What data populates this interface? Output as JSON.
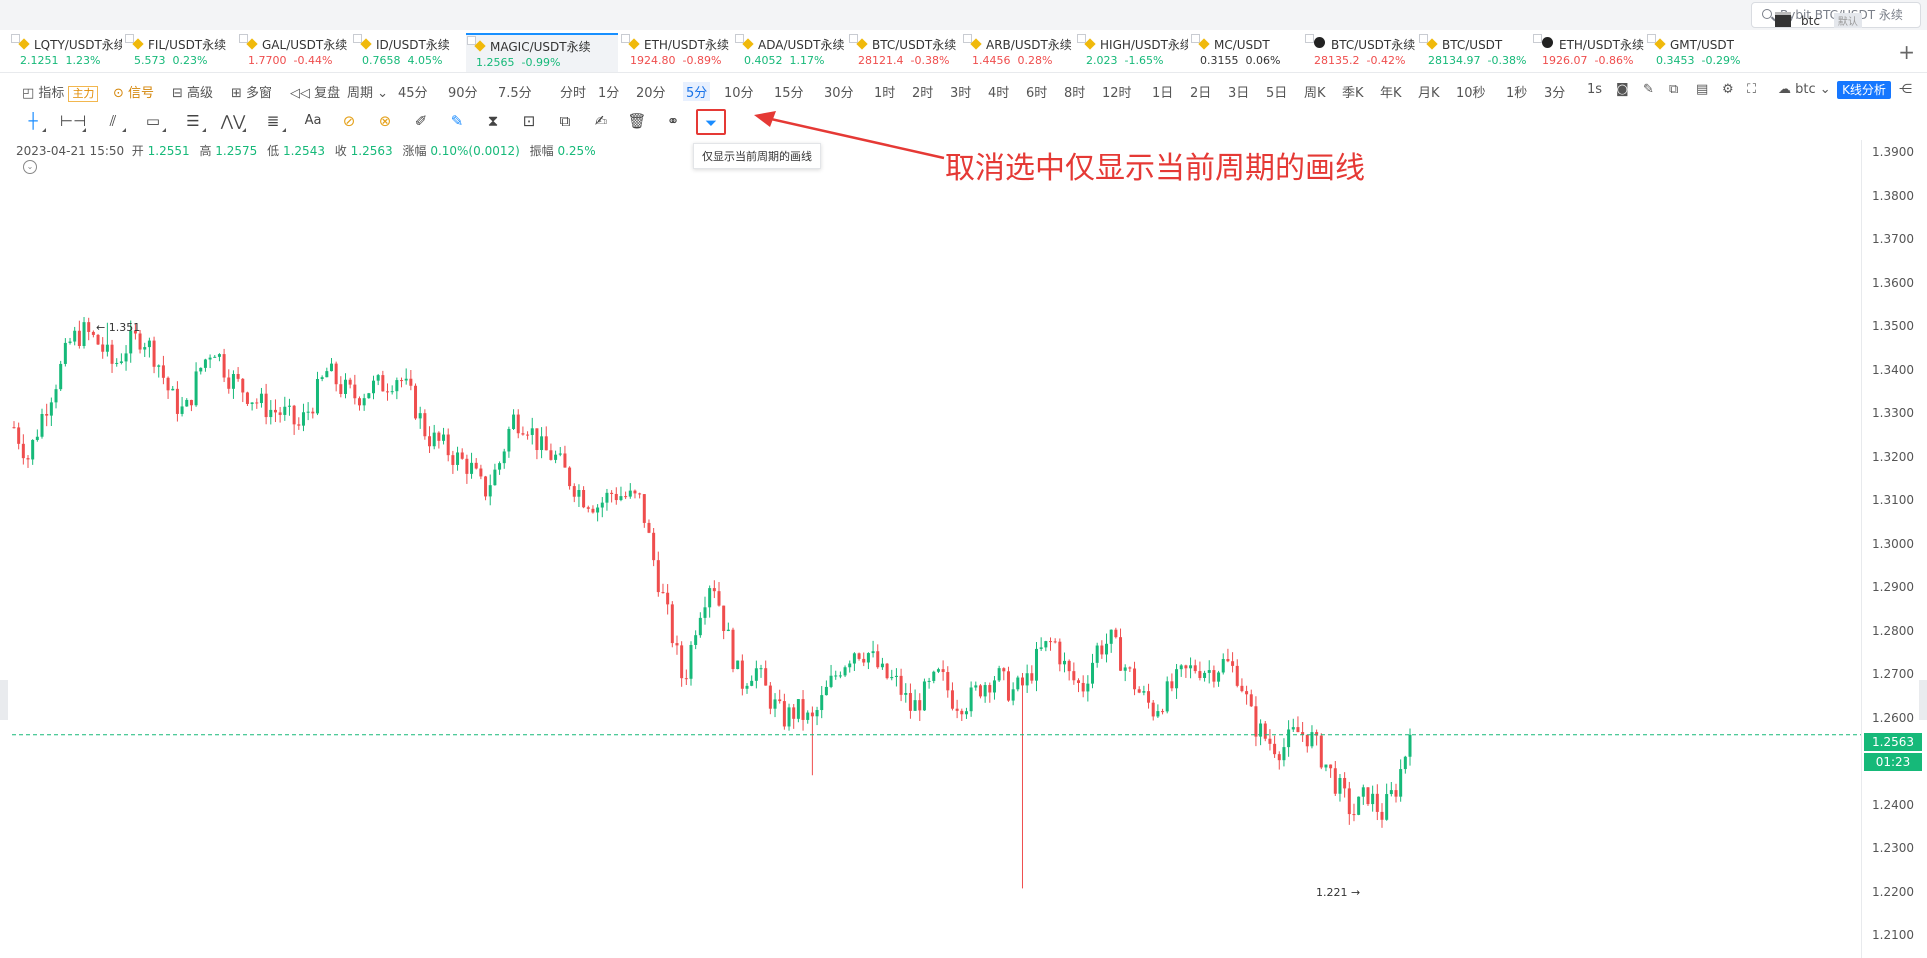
{
  "search": {
    "placeholder": "Bybit BTC/USDT 永续"
  },
  "tickers": [
    {
      "name": "LQTY/USDT永续",
      "price": "2.1251",
      "change": "1.23%",
      "dir": "up",
      "icon": "dot"
    },
    {
      "name": "FIL/USDT永续",
      "price": "5.573",
      "change": "0.23%",
      "dir": "up",
      "icon": "dot"
    },
    {
      "name": "GAL/USDT永续",
      "price": "1.7700",
      "change": "-0.44%",
      "dir": "dn",
      "icon": "binance"
    },
    {
      "name": "ID/USDT永续",
      "price": "0.7658",
      "change": "4.05%",
      "dir": "up",
      "icon": "binance"
    },
    {
      "name": "MAGIC/USDT永续",
      "price": "1.2565",
      "change": "-0.99%",
      "dir": "up",
      "icon": "binance",
      "active": true
    },
    {
      "name": "ETH/USDT永续",
      "price": "1924.80",
      "change": "-0.89%",
      "dir": "dn",
      "icon": "binance"
    },
    {
      "name": "ADA/USDT永续",
      "price": "0.4052",
      "change": "1.17%",
      "dir": "up",
      "icon": "binance"
    },
    {
      "name": "BTC/USDT永续",
      "price": "28121.4",
      "change": "-0.38%",
      "dir": "dn",
      "icon": "binance"
    },
    {
      "name": "ARB/USDT永续",
      "price": "1.4456",
      "change": "0.28%",
      "dir": "dn",
      "icon": "binance"
    },
    {
      "name": "HIGH/USDT永续",
      "price": "2.023",
      "change": "-1.65%",
      "dir": "up",
      "icon": "binance"
    },
    {
      "name": "MC/USDT",
      "price": "0.3155",
      "change": "0.06%",
      "dir": "neu",
      "icon": "binance"
    },
    {
      "name": "BTC/USDT永续",
      "price": "28135.2",
      "change": "-0.42%",
      "dir": "dn",
      "icon": "okx"
    },
    {
      "name": "BTC/USDT",
      "price": "28134.97",
      "change": "-0.38%",
      "dir": "up",
      "icon": "binance"
    },
    {
      "name": "ETH/USDT永续",
      "price": "1926.07",
      "change": "-0.86%",
      "dir": "dn",
      "icon": "okx"
    },
    {
      "name": "GMT/USDT",
      "price": "0.3453",
      "change": "-0.29%",
      "dir": "up",
      "icon": "binance"
    }
  ],
  "lang": {
    "label": "btc",
    "tag": "默认"
  },
  "toolbar": {
    "indicator": "指标",
    "indicator_badge": "主力",
    "signal": "信号",
    "advanced": "高级",
    "multiwin": "多窗",
    "replay": "复盘",
    "period": "周期",
    "periods": [
      "45分",
      "90分",
      "7.5分",
      "分时",
      "1分",
      "20分",
      "5分",
      "10分",
      "15分",
      "30分",
      "1时",
      "2时",
      "3时",
      "4时",
      "6时",
      "8时",
      "12时",
      "1日",
      "2日",
      "3日",
      "5日",
      "周K",
      "季K",
      "年K",
      "月K",
      "10秒",
      "1秒",
      "3分"
    ],
    "selected_period": "5分",
    "right_interval": "1s",
    "right_symbol": "btc",
    "kline_button": "K线分析"
  },
  "drawtools": {
    "font_tool": "Aa",
    "tooltip": "仅显示当前周期的画线"
  },
  "annotation": {
    "text": "取消选中仅显示当前周期的画线"
  },
  "ohlc": {
    "datetime": "2023-04-21 15:50",
    "open_label": "开",
    "open": "1.2551",
    "high_label": "高",
    "high": "1.2575",
    "low_label": "低",
    "low": "1.2543",
    "close_label": "收",
    "close": "1.2563",
    "change_label": "涨幅",
    "change": "0.10%(0.0012)",
    "amp_label": "振幅",
    "amp": "0.25%"
  },
  "chart_data": {
    "type": "candlestick",
    "symbol": "MAGIC/USDT永续",
    "interval": "5分",
    "y_ticks": [
      "1.3900",
      "1.3800",
      "1.3700",
      "1.3600",
      "1.3500",
      "1.3400",
      "1.3300",
      "1.3200",
      "1.3100",
      "1.3000",
      "1.2900",
      "1.2800",
      "1.2700",
      "1.2600",
      "1.2400",
      "1.2300",
      "1.2200",
      "1.2100"
    ],
    "ylim": [
      1.205,
      1.393
    ],
    "close_path": [
      1.327,
      1.32,
      1.33,
      1.338,
      1.347,
      1.349,
      1.346,
      1.341,
      1.346,
      1.348,
      1.343,
      1.334,
      1.33,
      1.34,
      1.346,
      1.339,
      1.336,
      1.333,
      1.331,
      1.33,
      1.327,
      1.333,
      1.34,
      1.336,
      1.334,
      1.336,
      1.337,
      1.339,
      1.333,
      1.325,
      1.323,
      1.32,
      1.318,
      1.312,
      1.318,
      1.329,
      1.328,
      1.322,
      1.32,
      1.315,
      1.311,
      1.309,
      1.312,
      1.311,
      1.31,
      1.295,
      1.282,
      1.268,
      1.284,
      1.293,
      1.28,
      1.268,
      1.272,
      1.265,
      1.26,
      1.262,
      1.259,
      1.266,
      1.272,
      1.276,
      1.275,
      1.27,
      1.268,
      1.262,
      1.266,
      1.27,
      1.264,
      1.264,
      1.268,
      1.27,
      1.266,
      1.268,
      1.275,
      1.278,
      1.27,
      1.267,
      1.276,
      1.278,
      1.272,
      1.266,
      1.262,
      1.266,
      1.27,
      1.272,
      1.271,
      1.273,
      1.27,
      1.259,
      1.255,
      1.253,
      1.257,
      1.256,
      1.25,
      1.244,
      1.238,
      1.243,
      1.238,
      1.244,
      1.256
    ],
    "high": "1.351",
    "low": "1.221",
    "last_price": "1.2563",
    "countdown": "01:23"
  }
}
